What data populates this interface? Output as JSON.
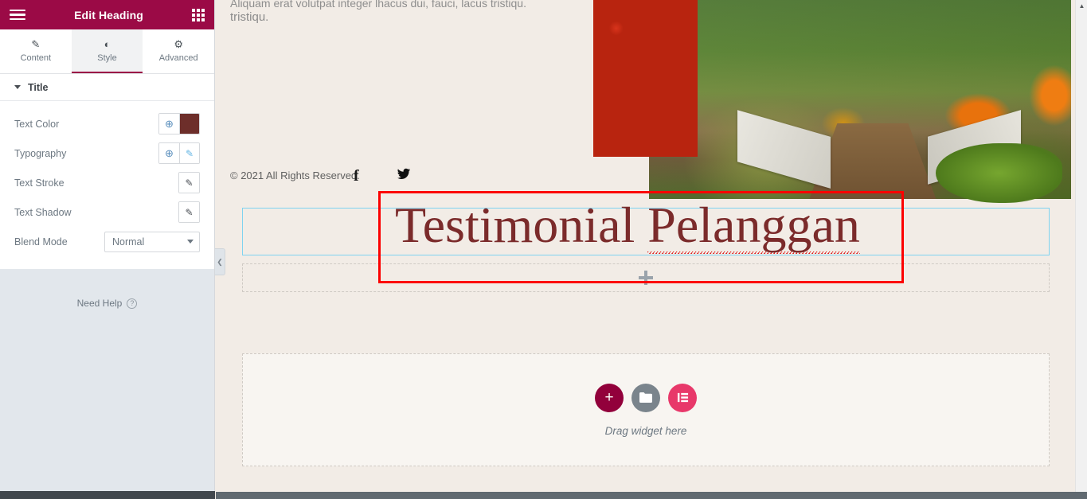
{
  "panel": {
    "header": {
      "title": "Edit Heading",
      "menu_icon": "hamburger-icon",
      "grid_icon": "widgets-grid-icon"
    },
    "tabs": [
      {
        "label": "Content",
        "icon": "pencil-icon",
        "glyph": "✎",
        "active": false
      },
      {
        "label": "Style",
        "icon": "contrast-half-circle-icon",
        "glyph": "◐",
        "active": true
      },
      {
        "label": "Advanced",
        "icon": "gear-icon",
        "glyph": "⚙",
        "active": false
      }
    ],
    "section": {
      "title": "Title",
      "expanded": true
    },
    "controls": [
      {
        "label": "Text Color",
        "type": "color",
        "globe": "⊕",
        "value_color": "#6d2e2a"
      },
      {
        "label": "Typography",
        "type": "edit",
        "globe": "⊕",
        "edit_glyph": "✎"
      },
      {
        "label": "Text Stroke",
        "type": "edit",
        "edit_glyph": "✎"
      },
      {
        "label": "Text Shadow",
        "type": "edit",
        "edit_glyph": "✎"
      },
      {
        "label": "Blend Mode",
        "type": "select",
        "value": "Normal"
      }
    ],
    "need_help": {
      "label": "Need Help",
      "icon": "question-mark-icon",
      "glyph": "?"
    },
    "collapse_handle": {
      "icon": "chevron-left-icon",
      "glyph": "❮"
    },
    "colors": {
      "header_bg": "#9b0a46",
      "panel_bg": "#e2e7ec",
      "accent": "#9b0a46"
    }
  },
  "canvas": {
    "cut_text": "Aliquam erat volutpat integer lhacus dui, fauci, lacus tristiqu.",
    "tristiqu": "tristiqu.",
    "copyright": "© 2021 All Rights Reserved.",
    "social": [
      {
        "name": "facebook-icon",
        "glyph": "f"
      },
      {
        "name": "twitter-icon",
        "glyph": "🐦"
      }
    ],
    "heading": {
      "text_before": "Testimonial ",
      "misspelled_word": "Pelanggan",
      "color": "#7b2b2b"
    },
    "add_section_icon": "plus-icon",
    "drop_area": {
      "label": "Drag widget here",
      "buttons": [
        {
          "name": "add-new-section-button",
          "glyph": "+",
          "color": "#92003b"
        },
        {
          "name": "template-library-folder-button",
          "glyph": "🗀",
          "color": "#7a848c"
        },
        {
          "name": "elementor-logo-button",
          "glyph": "⇤",
          "color": "#e8386a"
        }
      ]
    },
    "scrollbar": {
      "up_arrow": "▲"
    },
    "annotation": {
      "type": "red-rectangle-highlight",
      "color": "#fc0000"
    }
  }
}
